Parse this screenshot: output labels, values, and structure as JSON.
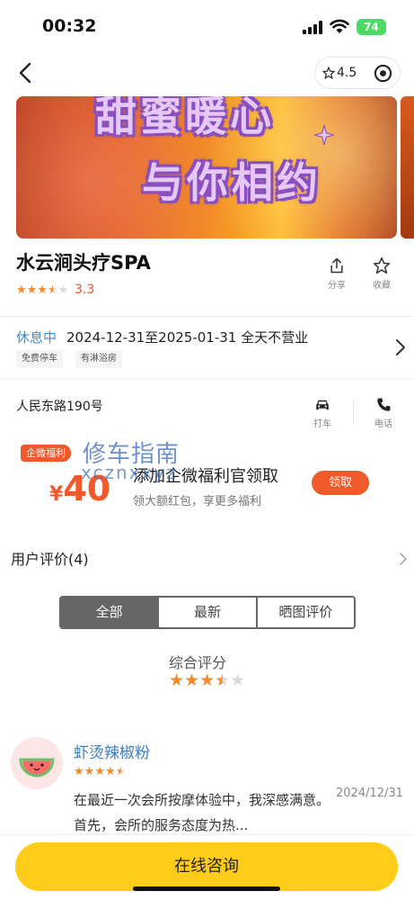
{
  "status_bar": {
    "time": "00:32",
    "battery": "74"
  },
  "nav": {
    "rating": "4.5"
  },
  "banner": {
    "line1": "甜蜜暖心",
    "line2": "与你相约"
  },
  "shop": {
    "name": "水云涧头疗SPA",
    "score": "3.3",
    "stars": 3.5,
    "actions": {
      "share": "分享",
      "favorite": "收藏"
    }
  },
  "hours": {
    "status": "休息中",
    "detail": "2024-12-31至2025-01-31 全天不营业",
    "tags": [
      "免费停车",
      "有淋浴房"
    ]
  },
  "address": {
    "text": "人民东路190号",
    "actions": {
      "taxi": "打车",
      "phone": "电话"
    }
  },
  "promo": {
    "badge": "企微福利",
    "currency": "¥",
    "amount": "40",
    "title": "添加企微福利官领取",
    "subtitle": "领大额红包，享更多福利",
    "button": "领取"
  },
  "watermark": {
    "line1": "修车指南",
    "line2": "xcznxxyz"
  },
  "reviews": {
    "header": "用户评价(4)",
    "tabs": [
      "全部",
      "最新",
      "晒图评价"
    ],
    "active_tab": 0,
    "overall_label": "综合评分",
    "overall_stars": 3.5,
    "items": [
      {
        "user": "虾烫辣椒粉",
        "stars": 4.5,
        "date": "2024/12/31",
        "text": "在最近一次会所按摩体验中，我深感满意。首先，会所的服务态度为热..."
      }
    ]
  },
  "bottom": {
    "consult": "在线咨询"
  },
  "colors": {
    "accent": "#f05a2a",
    "star": "#f08a2a",
    "link": "#3a8fd6",
    "cta": "#ffcc1a"
  }
}
